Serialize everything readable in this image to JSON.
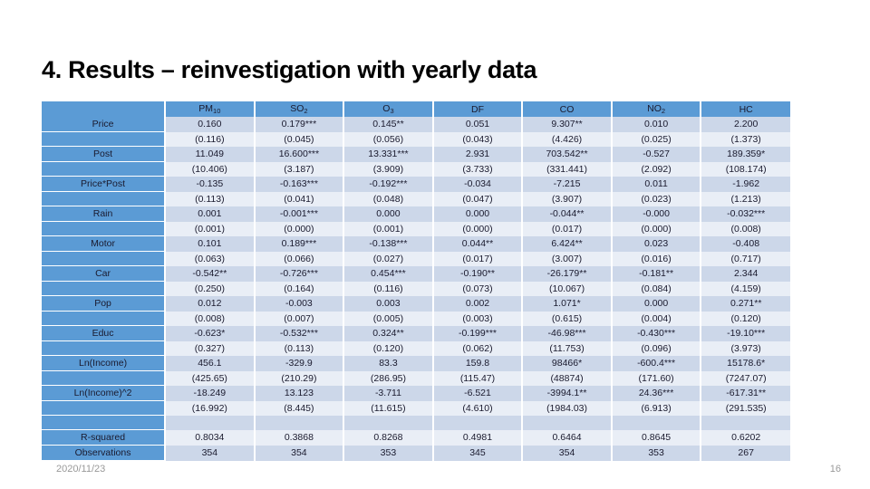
{
  "slide": {
    "title": "4. Results – reinvestigation with yearly data",
    "page_number": "16",
    "date": "2020/11/23",
    "accent_color": "#5b9bd5",
    "band_color_a": "#ccd7e9",
    "band_color_b": "#e9eef6"
  },
  "table": {
    "corner_label": "",
    "columns": [
      {
        "label": "PM",
        "sub": "10"
      },
      {
        "label": "SO",
        "sub": "2"
      },
      {
        "label": "O",
        "sub": "3"
      },
      {
        "label": "DF",
        "sub": ""
      },
      {
        "label": "CO",
        "sub": ""
      },
      {
        "label": "NO",
        "sub": "2"
      },
      {
        "label": "HC",
        "sub": ""
      }
    ],
    "rows": [
      {
        "label": "Price",
        "kind": "coef",
        "values": [
          "0.160",
          "0.179***",
          "0.145**",
          "0.051",
          "9.307**",
          "0.010",
          "2.200"
        ]
      },
      {
        "label": "",
        "kind": "se",
        "values": [
          "(0.116)",
          "(0.045)",
          "(0.056)",
          "(0.043)",
          "(4.426)",
          "(0.025)",
          "(1.373)"
        ]
      },
      {
        "label": "Post",
        "kind": "coef",
        "values": [
          "11.049",
          "16.600***",
          "13.331***",
          "2.931",
          "703.542**",
          "-0.527",
          "189.359*"
        ]
      },
      {
        "label": "",
        "kind": "se",
        "values": [
          "(10.406)",
          "(3.187)",
          "(3.909)",
          "(3.733)",
          "(331.441)",
          "(2.092)",
          "(108.174)"
        ]
      },
      {
        "label": "Price*Post",
        "kind": "coef",
        "values": [
          "-0.135",
          "-0.163***",
          "-0.192***",
          "-0.034",
          "-7.215",
          "0.011",
          "-1.962"
        ]
      },
      {
        "label": "",
        "kind": "se",
        "values": [
          "(0.113)",
          "(0.041)",
          "(0.048)",
          "(0.047)",
          "(3.907)",
          "(0.023)",
          "(1.213)"
        ]
      },
      {
        "label": "Rain",
        "kind": "coef",
        "values": [
          "0.001",
          "-0.001***",
          "0.000",
          "0.000",
          "-0.044**",
          "-0.000",
          "-0.032***"
        ]
      },
      {
        "label": "",
        "kind": "se",
        "values": [
          "(0.001)",
          "(0.000)",
          "(0.001)",
          "(0.000)",
          "(0.017)",
          "(0.000)",
          "(0.008)"
        ]
      },
      {
        "label": "Motor",
        "kind": "coef",
        "values": [
          "0.101",
          "0.189***",
          "-0.138***",
          "0.044**",
          "6.424**",
          "0.023",
          "-0.408"
        ]
      },
      {
        "label": "",
        "kind": "se",
        "values": [
          "(0.063)",
          "(0.066)",
          "(0.027)",
          "(0.017)",
          "(3.007)",
          "(0.016)",
          "(0.717)"
        ]
      },
      {
        "label": "Car",
        "kind": "coef",
        "values": [
          "-0.542**",
          "-0.726***",
          "0.454***",
          "-0.190**",
          "-26.179**",
          "-0.181**",
          "2.344"
        ]
      },
      {
        "label": "",
        "kind": "se",
        "values": [
          "(0.250)",
          "(0.164)",
          "(0.116)",
          "(0.073)",
          "(10.067)",
          "(0.084)",
          "(4.159)"
        ]
      },
      {
        "label": "Pop",
        "kind": "coef",
        "values": [
          "0.012",
          "-0.003",
          "0.003",
          "0.002",
          "1.071*",
          "0.000",
          "0.271**"
        ]
      },
      {
        "label": "",
        "kind": "se",
        "values": [
          "(0.008)",
          "(0.007)",
          "(0.005)",
          "(0.003)",
          "(0.615)",
          "(0.004)",
          "(0.120)"
        ]
      },
      {
        "label": "Educ",
        "kind": "coef",
        "values": [
          "-0.623*",
          "-0.532***",
          "0.324**",
          "-0.199***",
          "-46.98***",
          "-0.430***",
          "-19.10***"
        ]
      },
      {
        "label": "",
        "kind": "se",
        "values": [
          "(0.327)",
          "(0.113)",
          "(0.120)",
          "(0.062)",
          "(11.753)",
          "(0.096)",
          "(3.973)"
        ]
      },
      {
        "label": "Ln(Income)",
        "kind": "coef",
        "values": [
          "456.1",
          "-329.9",
          "83.3",
          "159.8",
          "98466*",
          "-600.4***",
          "15178.6*"
        ]
      },
      {
        "label": "",
        "kind": "se",
        "values": [
          "(425.65)",
          "(210.29)",
          "(286.95)",
          "(115.47)",
          "(48874)",
          "(171.60)",
          "(7247.07)"
        ]
      },
      {
        "label": "Ln(Income)^2",
        "kind": "coef",
        "values": [
          "-18.249",
          "13.123",
          "-3.711",
          "-6.521",
          "-3994.1**",
          "24.36***",
          "-617.31**"
        ]
      },
      {
        "label": "",
        "kind": "se",
        "values": [
          "(16.992)",
          "(8.445)",
          "(11.615)",
          "(4.610)",
          "(1984.03)",
          "(6.913)",
          "(291.535)"
        ]
      },
      {
        "label": "",
        "kind": "spacer",
        "values": [
          "",
          "",
          "",
          "",
          "",
          "",
          ""
        ]
      },
      {
        "label": "R-squared",
        "kind": "rsq",
        "values": [
          "0.8034",
          "0.3868",
          "0.8268",
          "0.4981",
          "0.6464",
          "0.8645",
          "0.6202"
        ]
      },
      {
        "label": "Observations",
        "kind": "obs",
        "values": [
          "354",
          "354",
          "353",
          "345",
          "354",
          "353",
          "267"
        ]
      }
    ]
  }
}
